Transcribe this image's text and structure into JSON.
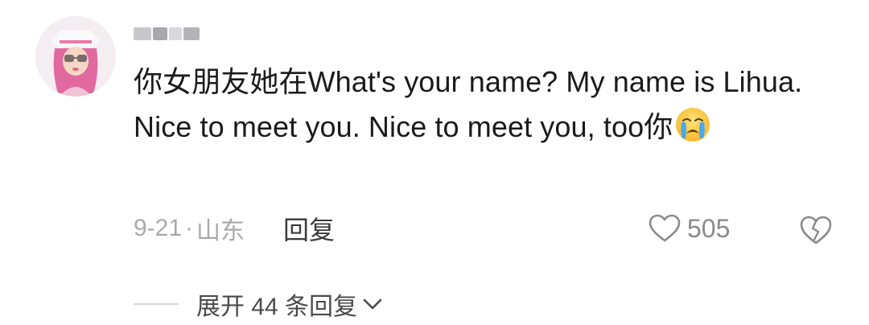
{
  "comment": {
    "username": "",
    "text_parts": [
      "你女朋友她在What's your name?   My name is Lihua. Nice to meet you. Nice to meet you, too你"
    ],
    "emoji_icon": "loudly-crying-face-icon",
    "date": "9-21",
    "separator": "·",
    "location": "山东",
    "reply_label": "回复",
    "like_count": "505",
    "expand_label": "展开 44 条回复"
  },
  "colors": {
    "text": "#1a1a1a",
    "meta": "#a9a9ad",
    "like": "#8a8a8e"
  }
}
